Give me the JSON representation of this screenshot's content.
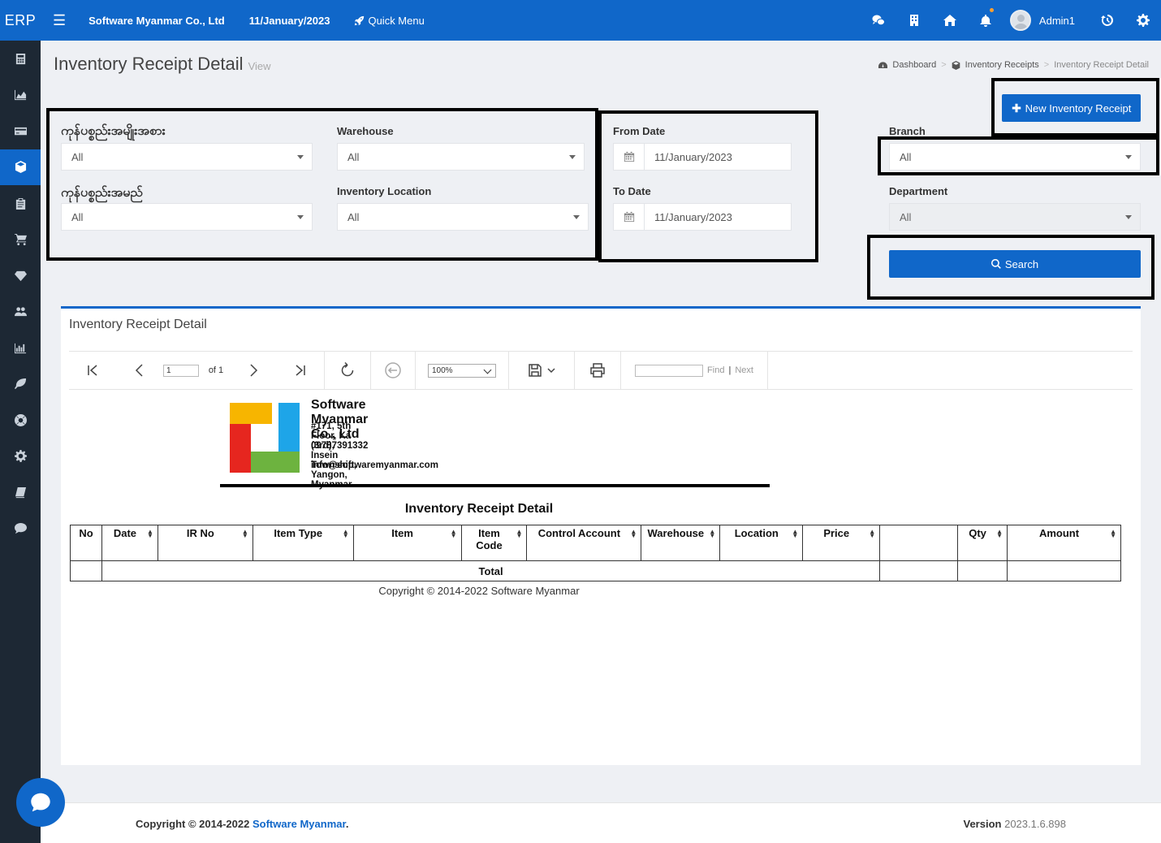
{
  "topbar": {
    "logo": "ERP",
    "company": "Software Myanmar Co., Ltd",
    "date": "11/January/2023",
    "quick_menu": "Quick Menu",
    "user": "Admin1",
    "icons": [
      "wechat-icon",
      "building-icon",
      "home-icon",
      "bell-icon",
      "history-icon",
      "gear-icon"
    ]
  },
  "sidebar": {
    "items": [
      "calculator-icon",
      "chart-area-icon",
      "credit-card-icon",
      "cube-icon",
      "clipboard-icon",
      "cart-icon",
      "diamond-icon",
      "users-icon",
      "bar-chart-icon",
      "leaf-icon",
      "life-ring-icon",
      "cog-icon",
      "book-icon",
      "comment-icon"
    ],
    "active_index": 3
  },
  "page": {
    "title": "Inventory Receipt Detail",
    "subtitle": "View"
  },
  "breadcrumb": {
    "dashboard": "Dashboard",
    "receipts": "Inventory Receipts",
    "current": "Inventory Receipt Detail",
    "separator": ">"
  },
  "filters": {
    "item_type_label": "ကုန်ပစ္စည်းအမျိုးအစား",
    "item_type_value": "All",
    "item_name_label": "ကုန်ပစ္စည်းအမည်",
    "item_name_value": "All",
    "warehouse_label": "Warehouse",
    "warehouse_value": "All",
    "location_label": "Inventory Location",
    "location_value": "All",
    "from_date_label": "From Date",
    "from_date_value": "11/January/2023",
    "to_date_label": "To Date",
    "to_date_value": "11/January/2023",
    "branch_label": "Branch",
    "branch_value": "All",
    "department_label": "Department",
    "department_value": "All"
  },
  "buttons": {
    "new_receipt": "New Inventory Receipt",
    "search": "Search"
  },
  "report_panel": {
    "title": "Inventory Receipt Detail",
    "toolbar": {
      "page": "1",
      "of": "of 1",
      "zoom": "100%",
      "find": "Find",
      "pipe": "|",
      "next": "Next"
    }
  },
  "report": {
    "company": "Software Myanmar Co., Ltd",
    "address": "#171, 5th Floor, Ka (3rd), Insein Township, Yangon, Myanmar",
    "phone": "09787391332",
    "email": "info@softwaremyanmar.com",
    "title": "Inventory Receipt Detail",
    "columns": [
      "No",
      "Date",
      "IR No",
      "Item Type",
      "Item",
      "Item Code",
      "Control Account",
      "Warehouse",
      "Location",
      "Price",
      "",
      "Qty",
      "Amount"
    ],
    "total_label": "Total",
    "copyright": "Copyright © 2014-2022 Software Myanmar"
  },
  "footer": {
    "copyright_prefix": "Copyright © 2014-2022 ",
    "brand": "Software Myanmar",
    "period": ".",
    "version_label": "Version",
    "version": "2023.1.6.898"
  },
  "colors": {
    "primary": "#1067c9",
    "sidebar": "#1d2834"
  }
}
